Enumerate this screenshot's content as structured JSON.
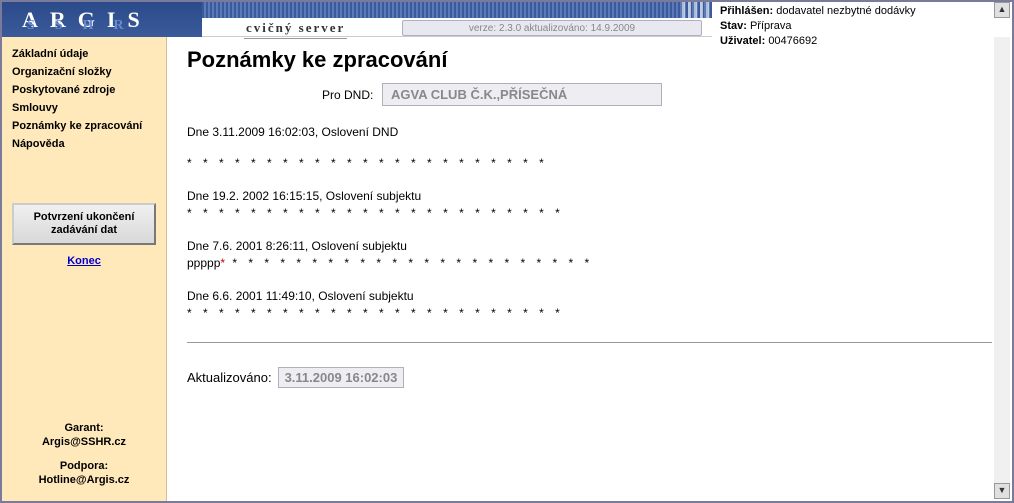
{
  "header": {
    "logo": "ARGIS",
    "logo_sub": "SSHR",
    "server_label": "cvičný server",
    "version_text": "verze: 2.3.0 aktualizováno: 14.9.2009",
    "login_label": "Přihlášen:",
    "login_value": "dodavatel nezbytné dodávky",
    "state_label": "Stav:",
    "state_value": "Příprava",
    "user_label": "Uživatel:",
    "user_value": "00476692"
  },
  "sidebar": {
    "items": [
      {
        "label": "Základní údaje"
      },
      {
        "label": "Organizační složky"
      },
      {
        "label": "Poskytované zdroje"
      },
      {
        "label": "Smlouvy"
      },
      {
        "label": "Poznámky ke zpracování"
      },
      {
        "label": "Nápověda"
      }
    ],
    "confirm_btn": "Potvrzení ukončení zadávání dat",
    "konec": "Konec",
    "garant_label": "Garant:",
    "garant_value": "Argis@SSHR.cz",
    "support_label": "Podpora:",
    "support_value": "Hotline@Argis.cz"
  },
  "main": {
    "title": "Poznámky ke zpracování",
    "field_label": "Pro DND:",
    "field_value": "AGVA CLUB Č.K.,PŘÍSEČNÁ",
    "entries": [
      {
        "line": "Dne 3.11.2009 16:02:03, Oslovení DND",
        "stars": "* * * * * * * * * * * * * * * * * * * * * * *",
        "prefix": ""
      },
      {
        "line": "Dne 19.2. 2002 16:15:15, Oslovení subjektu",
        "stars": "* * * * * * * * * * * * * * * * * * * * * * * *",
        "prefix": ""
      },
      {
        "line": "Dne 7.6. 2001 8:26:11, Oslovení subjektu",
        "stars": " * * * * * * * * * * * * * * * * * * * * * * *",
        "prefix": "ppppp"
      },
      {
        "line": "Dne 6.6. 2001 11:49:10, Oslovení subjektu",
        "stars": "* * * * * * * * * * * * * * * * * * * * * * * *",
        "prefix": ""
      }
    ],
    "updated_label": "Aktualizováno:",
    "updated_value": "3.11.2009 16:02:03"
  }
}
